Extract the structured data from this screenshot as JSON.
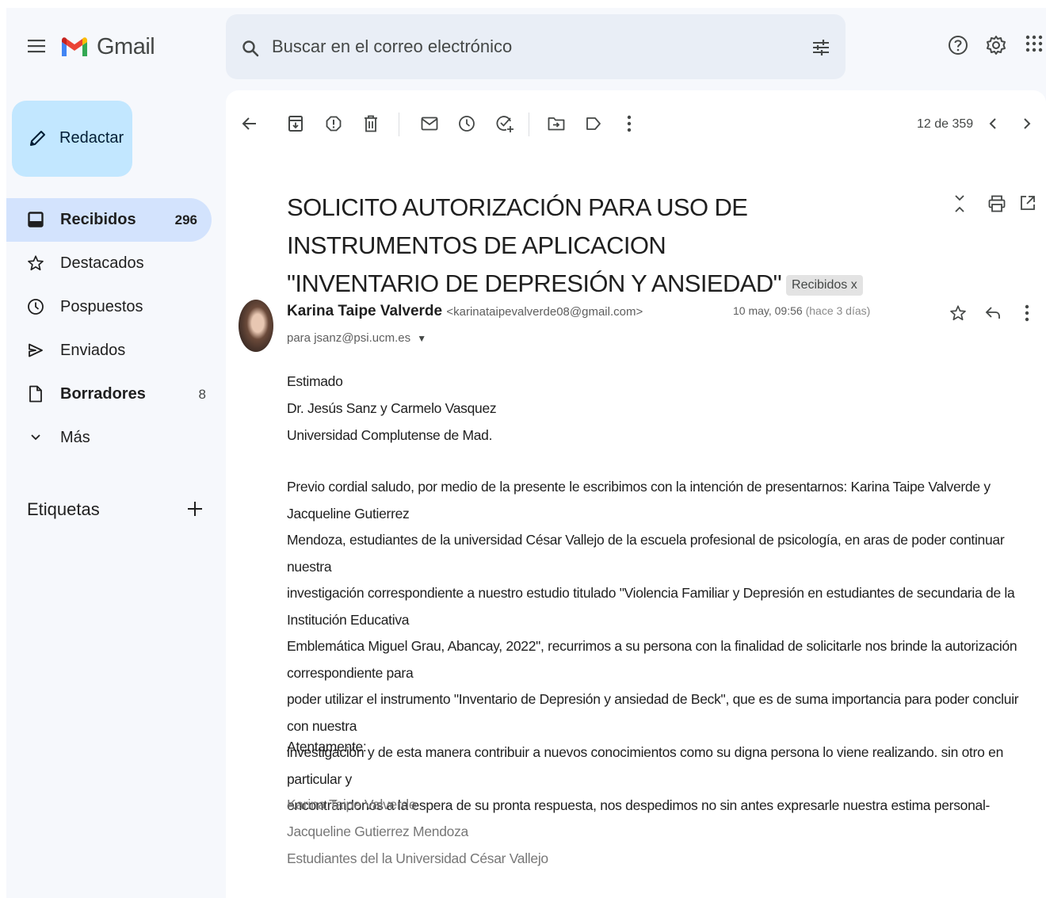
{
  "app": {
    "name": "Gmail",
    "brand_colors": {
      "red": "#ea4335",
      "blue": "#4285f4",
      "green": "#34a853",
      "yellow": "#fbbc04",
      "compose": "#c2e7ff",
      "active": "#d3e3fd"
    }
  },
  "search": {
    "placeholder": "Buscar en el correo electrónico"
  },
  "top_icons": [
    "help-icon",
    "gear-icon",
    "apps-grid-icon"
  ],
  "compose": {
    "label": "Redactar"
  },
  "sidebar": {
    "items": [
      {
        "label": "Recibidos",
        "count": "296",
        "icon": "inbox-icon"
      },
      {
        "label": "Destacados",
        "count": "",
        "icon": "star-icon"
      },
      {
        "label": "Pospuestos",
        "count": "",
        "icon": "clock-icon"
      },
      {
        "label": "Enviados",
        "count": "",
        "icon": "send-icon"
      },
      {
        "label": "Borradores",
        "count": "8",
        "icon": "file-icon"
      },
      {
        "label": "Más",
        "count": "",
        "icon": "chevron-down-icon"
      }
    ],
    "labels_heading": "Etiquetas"
  },
  "toolbar": {
    "pager": "12 de 359"
  },
  "email": {
    "subject_line1": "SOLICITO AUTORIZACIÓN PARA USO DE INSTRUMENTOS DE APLICACION",
    "subject_line2": "\"INVENTARIO DE DEPRESIÓN Y ANSIEDAD\"",
    "tag": "Recibidos",
    "tag_close": "x",
    "sender_name": "Karina Taipe Valverde",
    "sender_email": "<karinataipevalverde08@gmail.com>",
    "recipient": "para jsanz@psi.ucm.es",
    "date": "10 may, 09:56",
    "date_relative": "(hace 3 días)",
    "greeting": [
      "Estimado",
      "Dr. Jesús Sanz y Carmelo Vasquez",
      "Universidad Complutense de Mad."
    ],
    "paragraph_lines": [
      "Previo cordial saludo, por medio de la presente le escribimos con la intención de presentarnos: Karina Taipe Valverde y Jacqueline Gutierrez",
      "Mendoza, estudiantes de la universidad César Vallejo de la escuela profesional de psicología, en aras de poder continuar nuestra",
      "investigación correspondiente a nuestro estudio titulado \"Violencia Familiar y Depresión en estudiantes de secundaria de la Institución Educativa",
      "Emblemática Miguel Grau, Abancay, 2022\", recurrimos a su persona  con la finalidad de solicitarle nos brinde la autorización correspondiente para",
      "poder utilizar el instrumento \"Inventario de Depresión y ansiedad de Beck\", que es de suma importancia para poder concluir con nuestra",
      "investigación  y de esta manera contribuir a nuevos conocimientos como su digna persona lo viene realizando. sin otro en particular y",
      "encontrándonos a la espera de su pronta respuesta, nos despedimos no sin antes expresarle nuestra estima personal-"
    ],
    "closing": "Atentamente:",
    "signature": [
      "Karina Taipe Valverde",
      "Jacqueline Gutierrez Mendoza",
      "Estudiantes del la Universidad César Vallejo"
    ]
  }
}
